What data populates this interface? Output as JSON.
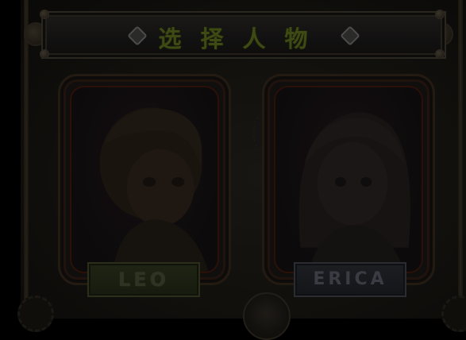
{
  "screen": {
    "title": "选择人物",
    "title_color": "#3e4a14",
    "theme": "dimmed"
  },
  "characters": [
    {
      "name": "LEO",
      "plate_color": "#1f2414"
    },
    {
      "name": "ERICA",
      "plate_color": "#1c1e22"
    }
  ],
  "icons": {
    "left_ornament": "diamond-icon",
    "right_ornament": "diamond-icon",
    "bottom_knob": "gear-icon"
  }
}
